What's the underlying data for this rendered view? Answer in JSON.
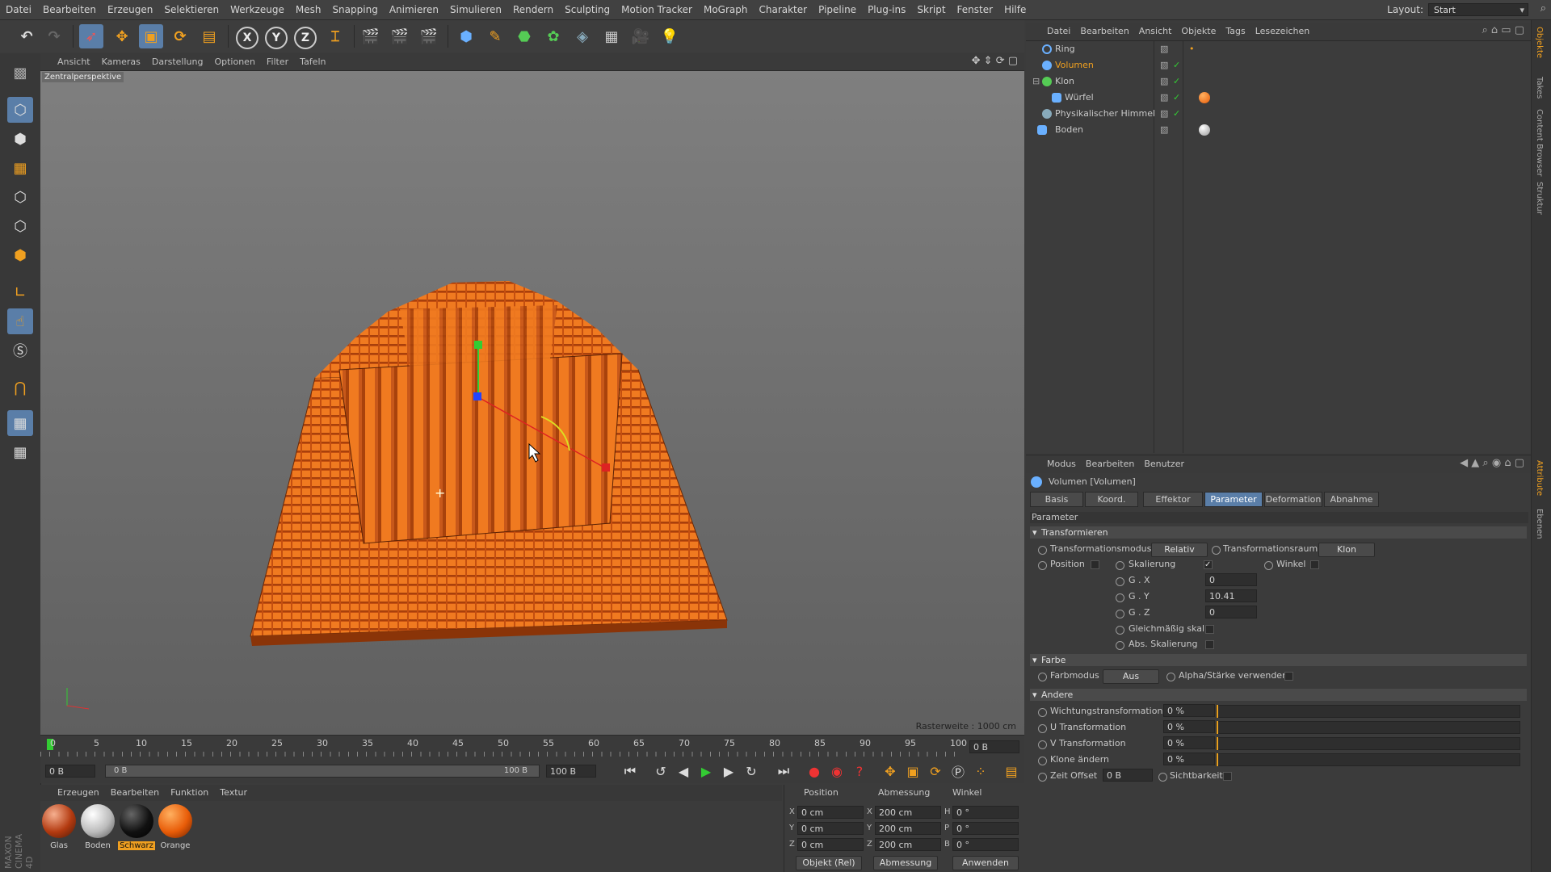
{
  "menubar": {
    "items": [
      "Datei",
      "Bearbeiten",
      "Erzeugen",
      "Selektieren",
      "Werkzeuge",
      "Mesh",
      "Snapping",
      "Animieren",
      "Simulieren",
      "Rendern",
      "Sculpting",
      "Motion Tracker",
      "MoGraph",
      "Charakter",
      "Pipeline",
      "Plug-ins",
      "Skript",
      "Fenster",
      "Hilfe"
    ],
    "layout_label": "Layout:",
    "layout_value": "Start"
  },
  "toolbar": {
    "axis_x": "X",
    "axis_y": "Y",
    "axis_z": "Z"
  },
  "viewport": {
    "menu": [
      "Ansicht",
      "Kameras",
      "Darstellung",
      "Optionen",
      "Filter",
      "Tafeln"
    ],
    "camera_label": "Zentralperspektive",
    "raster": "Rasterweite : 1000 cm"
  },
  "timeline": {
    "ticks": [
      "0",
      "5",
      "10",
      "15",
      "20",
      "25",
      "30",
      "35",
      "40",
      "45",
      "50",
      "55",
      "60",
      "65",
      "70",
      "75",
      "80",
      "85",
      "90",
      "95",
      "100"
    ],
    "end_field": "0 B",
    "current": "0 B",
    "range_start": "0 B",
    "range_end": "100 B",
    "max": "100 B"
  },
  "materials": {
    "menu": [
      "Erzeugen",
      "Bearbeiten",
      "Funktion",
      "Textur"
    ],
    "items": [
      {
        "label": "Glas"
      },
      {
        "label": "Boden"
      },
      {
        "label": "Schwarz"
      },
      {
        "label": "Orange"
      }
    ]
  },
  "coords": {
    "headers": [
      "Position",
      "Abmessung",
      "Winkel"
    ],
    "rows": [
      {
        "axis": "X",
        "pos": "0 cm",
        "dimlabel": "X",
        "dim": "200 cm",
        "anglabel": "H",
        "ang": "0 °"
      },
      {
        "axis": "Y",
        "pos": "0 cm",
        "dimlabel": "Y",
        "dim": "200 cm",
        "anglabel": "P",
        "ang": "0 °"
      },
      {
        "axis": "Z",
        "pos": "0 cm",
        "dimlabel": "Z",
        "dim": "200 cm",
        "anglabel": "B",
        "ang": "0 °"
      }
    ],
    "mode": "Objekt (Rel)",
    "dim_mode": "Abmessung",
    "apply": "Anwenden"
  },
  "objects": {
    "menu": [
      "Datei",
      "Bearbeiten",
      "Ansicht",
      "Objekte",
      "Tags",
      "Lesezeichen"
    ],
    "items": [
      "Ring",
      "Volumen",
      "Klon",
      "Würfel",
      "Physikalischer Himmel",
      "Boden"
    ]
  },
  "attributes": {
    "menu": [
      "Modus",
      "Bearbeiten",
      "Benutzer"
    ],
    "title": "Volumen [Volumen]",
    "tabs": [
      "Basis",
      "Koord.",
      "Effektor",
      "Parameter",
      "Deformation",
      "Abnahme"
    ],
    "section_label": "Parameter",
    "sec_transform": "Transformieren",
    "transform_mode_label": "Transformationsmodus",
    "transform_mode": "Relativ",
    "transform_space_label": "Transformationsraum",
    "transform_space": "Klon",
    "position": "Position",
    "scale": "Skalierung",
    "angle": "Winkel",
    "gx_label": "G . X",
    "gx": "0",
    "gy_label": "G . Y",
    "gy": "10.41",
    "gz_label": "G . Z",
    "gz": "0",
    "uniform": "Gleichmäßig skal.",
    "abs_scale": "Abs. Skalierung",
    "sec_color": "Farbe",
    "color_mode_label": "Farbmodus",
    "color_mode": "Aus",
    "alpha": "Alpha/Stärke verwenden",
    "sec_other": "Andere",
    "weight_label": "Wichtungstransformation",
    "weight": "0 %",
    "u_label": "U Transformation",
    "u": "0 %",
    "v_label": "V Transformation",
    "v": "0 %",
    "clone_label": "Klone ändern",
    "clone": "0 %",
    "time_label": "Zeit Offset",
    "time": "0 B",
    "visibility": "Sichtbarkeit"
  },
  "side_tabs": [
    "Objekte",
    "Takes",
    "Content Browser",
    "Struktur",
    "Attribute",
    "Ebenen"
  ],
  "brand": "MAXON CINEMA 4D"
}
